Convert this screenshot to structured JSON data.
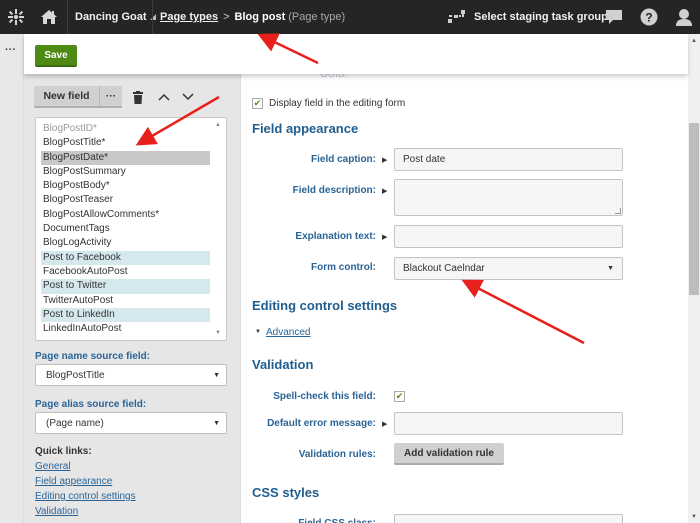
{
  "topbar": {
    "logo_icon": "kentico-logo-icon",
    "home_icon": "home-icon",
    "site_name": "Dancing Goat",
    "site_caret": "◢",
    "breadcrumb": {
      "parent": "Page types",
      "separator": ">",
      "current": "Blog post",
      "current_type": "(Page type)"
    },
    "staging_label": "Select staging task group",
    "icons": [
      "staging-icon",
      "chat-icon",
      "help-icon",
      "user-icon"
    ]
  },
  "leftstrip": {
    "more_label": "···"
  },
  "header": {
    "save_label": "Save"
  },
  "field_list_toolbar": {
    "new_field_label": "New field",
    "more_label": "···",
    "icons": [
      "trash-icon",
      "move-up-icon",
      "move-down-icon"
    ]
  },
  "field_list": {
    "items": [
      {
        "label": "BlogPostID*",
        "state": "disabled"
      },
      {
        "label": "BlogPostTitle*",
        "state": "normal"
      },
      {
        "label": "BlogPostDate*",
        "state": "selected"
      },
      {
        "label": "BlogPostSummary",
        "state": "normal"
      },
      {
        "label": "BlogPostBody*",
        "state": "normal"
      },
      {
        "label": "BlogPostTeaser",
        "state": "normal"
      },
      {
        "label": "BlogPostAllowComments*",
        "state": "normal"
      },
      {
        "label": "DocumentTags",
        "state": "normal"
      },
      {
        "label": "BlogLogActivity",
        "state": "normal"
      },
      {
        "label": "Post to Facebook",
        "state": "category"
      },
      {
        "label": "FacebookAutoPost",
        "state": "normal"
      },
      {
        "label": "Post to Twitter",
        "state": "category"
      },
      {
        "label": "TwitterAutoPost",
        "state": "normal"
      },
      {
        "label": "Post to LinkedIn",
        "state": "category"
      },
      {
        "label": "LinkedInAutoPost",
        "state": "normal"
      }
    ]
  },
  "page_name_source": {
    "label": "Page name source field:",
    "value": "BlogPostTitle"
  },
  "page_alias_source": {
    "label": "Page alias source field:",
    "value": "(Page name)"
  },
  "quick_links": {
    "title": "Quick links:",
    "items": [
      "General",
      "Field appearance",
      "Editing control settings",
      "Validation"
    ]
  },
  "main": {
    "display_field_label": "Display field in the editing form",
    "display_field_checked": true,
    "field_appearance": {
      "heading": "Field appearance",
      "field_caption_label": "Field caption:",
      "field_caption_value": "Post date",
      "field_description_label": "Field description:",
      "field_description_value": "",
      "explanation_text_label": "Explanation text:",
      "explanation_text_value": "",
      "form_control_label": "Form control:",
      "form_control_value": "Blackout Caelndar"
    },
    "editing_control": {
      "heading": "Editing control settings",
      "advanced_label": "Advanced"
    },
    "validation": {
      "heading": "Validation",
      "spellcheck_label": "Spell-check this field:",
      "spellcheck_checked": true,
      "default_error_label": "Default error message:",
      "default_error_value": "",
      "rules_label": "Validation rules:",
      "add_rule_label": "Add validation rule"
    },
    "css_styles": {
      "heading": "CSS styles",
      "field_css_label": "Field CSS class:"
    }
  },
  "colors": {
    "topbar_bg": "#262524",
    "save_green": "#4e8a14",
    "link_blue": "#2a6496",
    "heading_blue": "#1f5e8f",
    "selected_row": "#c8c8c8",
    "category_row": "#d4e8ee",
    "annotation_red": "#e8201c"
  }
}
